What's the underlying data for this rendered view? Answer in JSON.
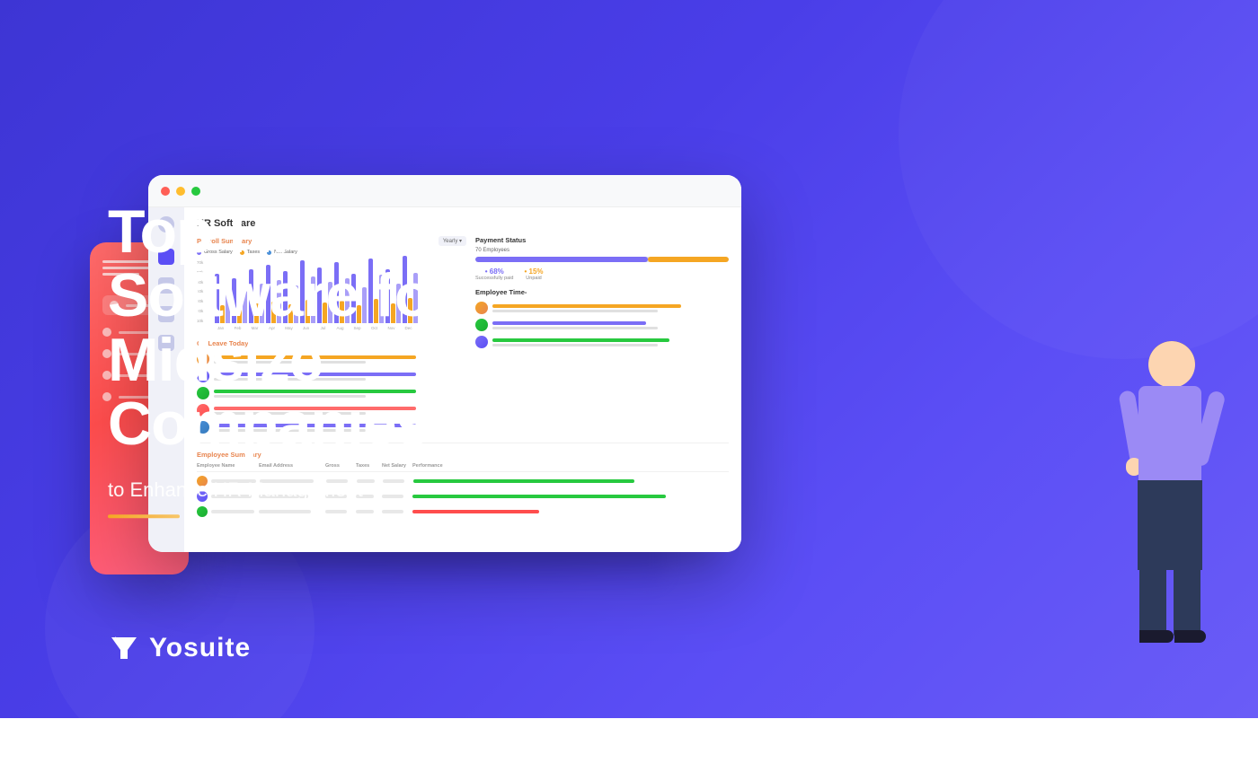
{
  "hero": {
    "background_color": "#4a3ee8",
    "headline_line1": "Top HR",
    "headline_line2": "Software for",
    "headline_line3": "Midsize",
    "headline_line4": "Companies",
    "subheadline": "to Enhance HR Management",
    "underline_color": "#f5a623"
  },
  "logo": {
    "icon": "Y",
    "name": "Yosuite"
  },
  "dashboard": {
    "title": "HR Software",
    "payroll": {
      "title": "Payroll Summary",
      "filter": "Yearly ▾",
      "legend": [
        {
          "label": "Gross Salary",
          "color": "purple"
        },
        {
          "label": "Taxes",
          "color": "orange"
        },
        {
          "label": "Net Salary",
          "color": "blue"
        }
      ],
      "y_labels": [
        "70k",
        "60k",
        "50k",
        "40k",
        "30k",
        "20k",
        "10k"
      ],
      "x_labels": [
        "Jan",
        "Feb",
        "Mar",
        "Apr",
        "May",
        "Jun",
        "Jul",
        "Aug",
        "Sep",
        "Oct",
        "Nov",
        "Dec"
      ],
      "bars": [
        {
          "gross": 55,
          "taxes": 20,
          "net": 40
        },
        {
          "gross": 50,
          "taxes": 18,
          "net": 36
        },
        {
          "gross": 60,
          "taxes": 22,
          "net": 44
        },
        {
          "gross": 65,
          "taxes": 24,
          "net": 48
        },
        {
          "gross": 58,
          "taxes": 21,
          "net": 42
        },
        {
          "gross": 70,
          "taxes": 26,
          "net": 52
        },
        {
          "gross": 62,
          "taxes": 23,
          "net": 46
        },
        {
          "gross": 68,
          "taxes": 25,
          "net": 50
        },
        {
          "gross": 55,
          "taxes": 20,
          "net": 40
        },
        {
          "gross": 72,
          "taxes": 27,
          "net": 54
        },
        {
          "gross": 60,
          "taxes": 22,
          "net": 44
        },
        {
          "gross": 75,
          "taxes": 28,
          "net": 56
        }
      ]
    },
    "payment_status": {
      "title": "Payment Status",
      "employee_count": "70 Employees",
      "paid_pct": 68,
      "unpaid_pct": 15,
      "paid_label": "Successfully paid",
      "unpaid_label": "Unpaid"
    },
    "on_leave": {
      "title": "On Leave Today",
      "employees": [
        {
          "color": "avatar-1"
        },
        {
          "color": "avatar-2"
        },
        {
          "color": "avatar-3"
        },
        {
          "color": "avatar-4"
        },
        {
          "color": "avatar-5"
        }
      ]
    },
    "employee_time": {
      "title": "Employee Time-",
      "employees": [
        {
          "color": "avatar-1",
          "bar_color": "#f5a623"
        },
        {
          "color": "avatar-3",
          "bar_color": "#7b6ef6"
        },
        {
          "color": "avatar-2",
          "bar_color": "#27c93f"
        }
      ]
    },
    "summary": {
      "title": "Employee Summary",
      "headers": [
        "Employee Name",
        "Email Address",
        "Gross",
        "Taxes",
        "Net Salary",
        "Performance"
      ],
      "rows": [
        {
          "perf_color": "#27c93f",
          "perf_width": 70
        },
        {
          "perf_color": "#27c93f",
          "perf_width": 80
        },
        {
          "perf_color": "#ff4d4d",
          "perf_width": 40
        }
      ]
    }
  }
}
